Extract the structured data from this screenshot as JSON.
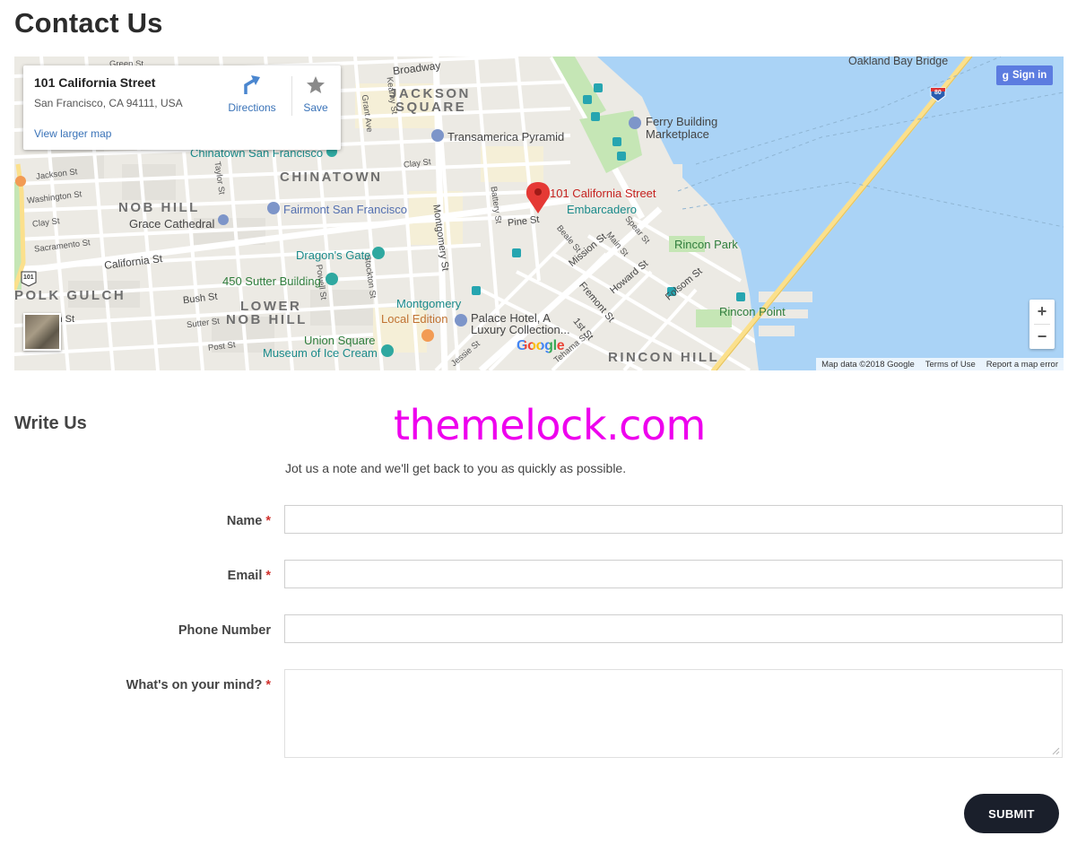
{
  "page": {
    "title": "Contact Us"
  },
  "map": {
    "card": {
      "place_name": "101 California Street",
      "address": "San Francisco, CA 94111, USA",
      "directions_label": "Directions",
      "save_label": "Save",
      "larger_map_label": "View larger map"
    },
    "signin_label": "Sign in",
    "zoom_in_label": "+",
    "zoom_out_label": "−",
    "google_logo": "Google",
    "attribution": {
      "data": "Map data ©2018 Google",
      "terms": "Terms of Use",
      "report": "Report a map error"
    },
    "labels": {
      "oakland_bay_bridge": "Oakland Bay Bridge",
      "broadway": "Broadway",
      "green_st": "Green St",
      "jackson_square_1": "JACKSON",
      "jackson_square_2": "SQUARE",
      "ferry_building_1": "Ferry Building",
      "ferry_building_2": "Marketplace",
      "transamerica": "Transamerica Pyramid",
      "chinatown_sf": "Chinatown San Francisco",
      "chinatown": "CHINATOWN",
      "jackson_st": "Jackson St",
      "washington_st": "Washington St",
      "clay_st_left": "Clay St",
      "clay_st": "Clay St",
      "sacramento_st": "Sacramento St",
      "nob_hill": "NOB HILL",
      "grace_cathedral": "Grace Cathedral",
      "fairmont": "Fairmont San Francisco",
      "california_st": "California St",
      "marker_label": "101 California Street",
      "embarcadero": "Embarcadero",
      "pine_st": "Pine St",
      "battery_st": "Battery St",
      "montgomery_st": "Montgomery St",
      "beale_st": "Beale St",
      "main_st": "Main St",
      "spear_st": "Spear St",
      "mission_st": "Mission St",
      "howard_st": "Howard St",
      "folsom_st": "Folsom St",
      "fremont_st": "Fremont St",
      "first_st": "1st St",
      "tehama_st": "Tehama St",
      "jessie_st": "Jessie St",
      "rincon_park": "Rincon Park",
      "rincon_point": "Rincon Point",
      "rincon_hill": "RINCON HILL",
      "polk_gulch": "POLK GULCH",
      "lower_nob_hill_1": "LOWER",
      "lower_nob_hill_2": "NOB HILL",
      "bush_st": "Bush St",
      "sutter_st": "Sutter St",
      "post_st": "Post St",
      "ash_st": "sh St",
      "dragons_gate": "Dragon's Gate",
      "sutter_building": "450 Sutter Building",
      "montgomery": "Montgomery",
      "local_edition": "Local Edition",
      "palace_hotel_1": "Palace Hotel, A",
      "palace_hotel_2": "Luxury Collection...",
      "union_square": "Union Square",
      "museum_ice_cream": "Museum of Ice Cream",
      "grant_ave": "Grant Ave",
      "stockton_st": "Stockton St",
      "taylor_st": "Taylor St",
      "powell_st": "Powell St",
      "kearny_st": "Kearny St",
      "hwy_101": "101",
      "hwy_80": "80"
    },
    "colors": {
      "water": "#aad3f6",
      "land": "#eceae4",
      "park": "#c5e6b5",
      "highway": "#fbe08c",
      "marker": "#e53935"
    }
  },
  "form": {
    "section_title": "Write Us",
    "watermark": "themelock.com",
    "intro": "Jot us a note and we'll get back to you as quickly as possible.",
    "required_mark": "*",
    "fields": {
      "name_label": "Name",
      "email_label": "Email",
      "phone_label": "Phone Number",
      "message_label": "What's on your mind?"
    },
    "submit_label": "SUBMIT"
  }
}
